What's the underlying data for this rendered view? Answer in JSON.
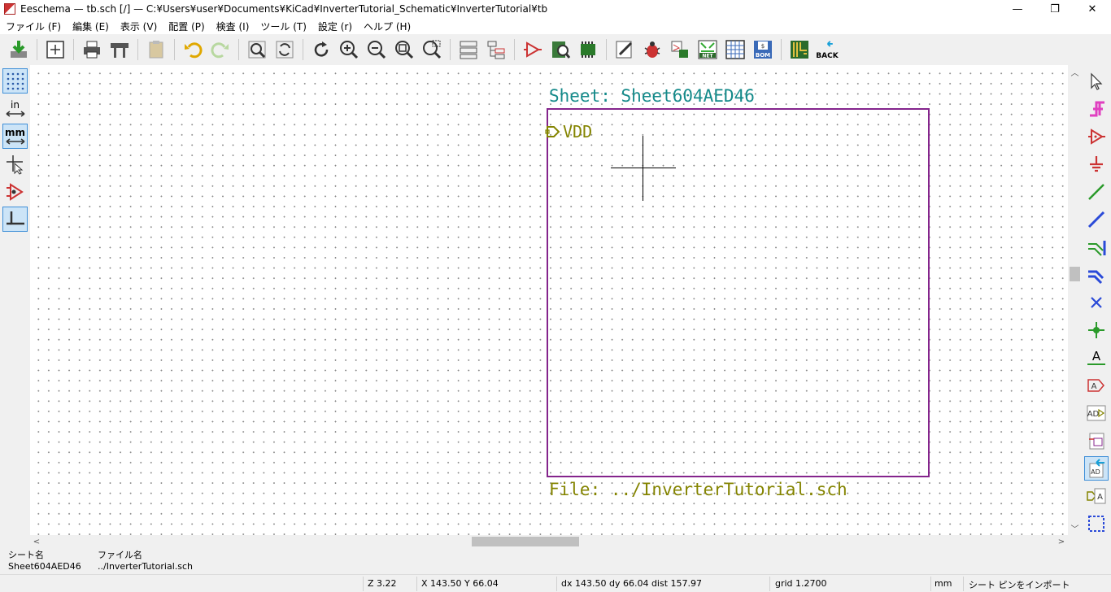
{
  "window": {
    "title": "Eeschema — tb.sch [/] — C:¥Users¥user¥Documents¥KiCad¥InverterTutorial_Schematic¥InverterTutorial¥tb",
    "minimize": "—",
    "maximize": "❐",
    "close": "✕"
  },
  "menu": [
    {
      "label": "ファイル (F)"
    },
    {
      "label": "編集 (E)"
    },
    {
      "label": "表示 (V)"
    },
    {
      "label": "配置 (P)"
    },
    {
      "label": "検査 (I)"
    },
    {
      "label": "ツール (T)"
    },
    {
      "label": "設定 (r)"
    },
    {
      "label": "ヘルプ (H)"
    }
  ],
  "toolbar": {
    "net_label": "NET",
    "bom_label": "BOM",
    "back_label": "BACK"
  },
  "left_toolbar": {
    "inch_label": "in",
    "mm_label": "mm"
  },
  "right_toolbar": {
    "text_label": "A"
  },
  "canvas": {
    "sheet_name": "Sheet: Sheet604AED46",
    "sheet_file": "File: ../InverterTutorial.sch",
    "pin_label": "VDD"
  },
  "info_panel": {
    "sheet_name_header": "シート名",
    "sheet_name_value": "Sheet604AED46",
    "file_name_header": "ファイル名",
    "file_name_value": "../InverterTutorial.sch"
  },
  "status": {
    "zoom": "Z 3.22",
    "cursor": "X 143.50  Y 66.04",
    "delta": "dx 143.50  dy 66.04  dist 157.97",
    "grid": "grid 1.2700",
    "units": "mm",
    "mode": "シート ピンをインポート"
  },
  "colors": {
    "sheet_border": "#84248c",
    "sheet_name": "#148a8a",
    "sheet_file": "#848400",
    "selection_highlight": "#cce4f7"
  }
}
